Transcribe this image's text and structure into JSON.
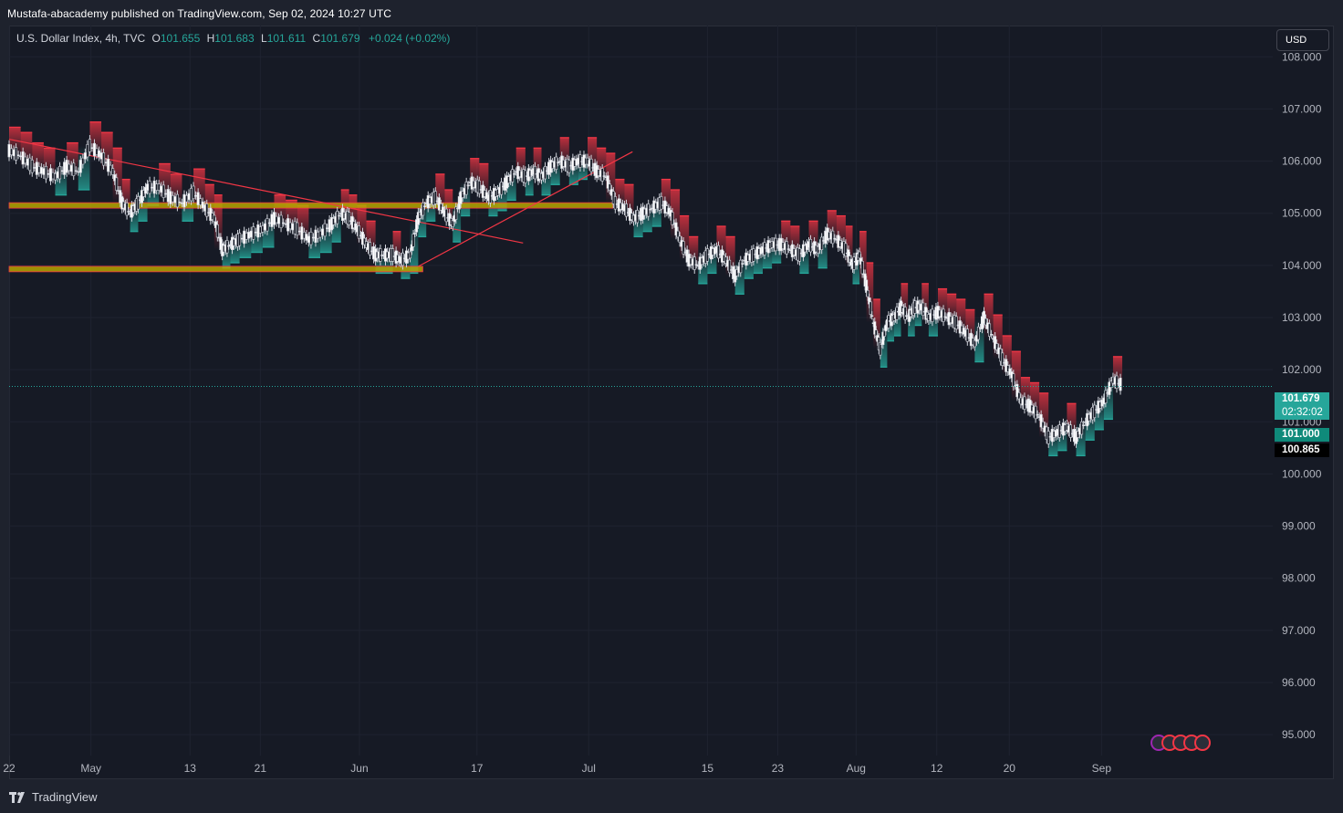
{
  "header": {
    "published": "Mustafa-abacademy published on TradingView.com, Sep 02, 2024 10:27 UTC"
  },
  "legend": {
    "symbol": "U.S. Dollar Index, 4h, TVC",
    "open_label": "O",
    "open": "101.655",
    "high_label": "H",
    "high": "101.683",
    "low_label": "L",
    "low": "101.611",
    "close_label": "C",
    "close": "101.679",
    "change": "+0.024 (+0.02%)"
  },
  "currency_button": "USD",
  "price_badges": {
    "last_price": "101.679",
    "countdown": "02:32:02",
    "level_green": "101.000",
    "level_black": "100.865"
  },
  "footer": {
    "brand": "TradingView"
  },
  "colors": {
    "bg": "#161a25",
    "up": "#26a69a",
    "down": "#f23645",
    "zone": "#b5a600",
    "trendline": "#f23645",
    "grid": "#1f2330"
  },
  "chart_data": {
    "type": "line",
    "symbol": "U.S. Dollar Index",
    "interval": "4h",
    "ylim": [
      94.6,
      108.6
    ],
    "y_ticks": [
      "108.000",
      "107.000",
      "106.000",
      "105.000",
      "104.000",
      "103.000",
      "102.000",
      "101.000",
      "100.000",
      "99.000",
      "98.000",
      "97.000",
      "96.000",
      "95.000"
    ],
    "x_tick_labels": [
      {
        "label": "22",
        "pos": 0.0
      },
      {
        "label": "May",
        "pos": 0.071
      },
      {
        "label": "13",
        "pos": 0.157
      },
      {
        "label": "21",
        "pos": 0.218
      },
      {
        "label": "Jun",
        "pos": 0.304
      },
      {
        "label": "17",
        "pos": 0.406
      },
      {
        "label": "Jul",
        "pos": 0.503
      },
      {
        "label": "15",
        "pos": 0.606
      },
      {
        "label": "23",
        "pos": 0.667
      },
      {
        "label": "Aug",
        "pos": 0.735
      },
      {
        "label": "12",
        "pos": 0.805
      },
      {
        "label": "20",
        "pos": 0.868
      },
      {
        "label": "Sep",
        "pos": 0.948
      }
    ],
    "series": [
      {
        "name": "",
        "points": [
          [
            0.0,
            106.2
          ],
          [
            0.01,
            106.1
          ],
          [
            0.02,
            105.9
          ],
          [
            0.03,
            105.8
          ],
          [
            0.04,
            105.7
          ],
          [
            0.05,
            105.9
          ],
          [
            0.06,
            105.8
          ],
          [
            0.07,
            106.3
          ],
          [
            0.08,
            106.1
          ],
          [
            0.09,
            105.8
          ],
          [
            0.098,
            105.2
          ],
          [
            0.105,
            105.0
          ],
          [
            0.112,
            105.2
          ],
          [
            0.12,
            105.5
          ],
          [
            0.13,
            105.5
          ],
          [
            0.14,
            105.3
          ],
          [
            0.15,
            105.2
          ],
          [
            0.16,
            105.4
          ],
          [
            0.17,
            105.1
          ],
          [
            0.178,
            104.9
          ],
          [
            0.185,
            104.3
          ],
          [
            0.192,
            104.4
          ],
          [
            0.2,
            104.5
          ],
          [
            0.21,
            104.6
          ],
          [
            0.22,
            104.7
          ],
          [
            0.23,
            104.9
          ],
          [
            0.24,
            104.8
          ],
          [
            0.25,
            104.7
          ],
          [
            0.26,
            104.5
          ],
          [
            0.27,
            104.6
          ],
          [
            0.28,
            104.8
          ],
          [
            0.288,
            105.0
          ],
          [
            0.295,
            104.9
          ],
          [
            0.302,
            104.7
          ],
          [
            0.31,
            104.4
          ],
          [
            0.318,
            104.2
          ],
          [
            0.325,
            104.2
          ],
          [
            0.333,
            104.2
          ],
          [
            0.34,
            104.1
          ],
          [
            0.348,
            104.2
          ],
          [
            0.355,
            104.9
          ],
          [
            0.362,
            105.2
          ],
          [
            0.37,
            105.3
          ],
          [
            0.378,
            105.0
          ],
          [
            0.385,
            104.8
          ],
          [
            0.392,
            105.3
          ],
          [
            0.4,
            105.6
          ],
          [
            0.408,
            105.5
          ],
          [
            0.416,
            105.3
          ],
          [
            0.424,
            105.4
          ],
          [
            0.432,
            105.6
          ],
          [
            0.44,
            105.8
          ],
          [
            0.448,
            105.7
          ],
          [
            0.455,
            105.8
          ],
          [
            0.462,
            105.7
          ],
          [
            0.47,
            105.9
          ],
          [
            0.478,
            106.0
          ],
          [
            0.486,
            105.9
          ],
          [
            0.494,
            106.0
          ],
          [
            0.502,
            106.0
          ],
          [
            0.51,
            105.8
          ],
          [
            0.518,
            105.7
          ],
          [
            0.526,
            105.2
          ],
          [
            0.534,
            105.1
          ],
          [
            0.542,
            104.9
          ],
          [
            0.55,
            105.0
          ],
          [
            0.558,
            105.1
          ],
          [
            0.566,
            105.2
          ],
          [
            0.574,
            105.0
          ],
          [
            0.582,
            104.5
          ],
          [
            0.59,
            104.1
          ],
          [
            0.598,
            104.0
          ],
          [
            0.606,
            104.2
          ],
          [
            0.614,
            104.3
          ],
          [
            0.622,
            104.1
          ],
          [
            0.63,
            103.8
          ],
          [
            0.638,
            104.1
          ],
          [
            0.646,
            104.2
          ],
          [
            0.654,
            104.3
          ],
          [
            0.662,
            104.4
          ],
          [
            0.67,
            104.4
          ],
          [
            0.678,
            104.3
          ],
          [
            0.686,
            104.2
          ],
          [
            0.694,
            104.4
          ],
          [
            0.702,
            104.3
          ],
          [
            0.71,
            104.6
          ],
          [
            0.718,
            104.5
          ],
          [
            0.726,
            104.3
          ],
          [
            0.732,
            104.0
          ],
          [
            0.738,
            104.2
          ],
          [
            0.744,
            103.6
          ],
          [
            0.75,
            102.9
          ],
          [
            0.756,
            102.4
          ],
          [
            0.762,
            102.9
          ],
          [
            0.768,
            103.0
          ],
          [
            0.774,
            103.2
          ],
          [
            0.78,
            103.0
          ],
          [
            0.786,
            103.2
          ],
          [
            0.792,
            103.2
          ],
          [
            0.798,
            103.0
          ],
          [
            0.806,
            103.1
          ],
          [
            0.814,
            103.0
          ],
          [
            0.822,
            102.9
          ],
          [
            0.83,
            102.7
          ],
          [
            0.838,
            102.5
          ],
          [
            0.846,
            103.0
          ],
          [
            0.854,
            102.6
          ],
          [
            0.862,
            102.2
          ],
          [
            0.87,
            101.9
          ],
          [
            0.878,
            101.4
          ],
          [
            0.886,
            101.3
          ],
          [
            0.894,
            101.1
          ],
          [
            0.902,
            100.7
          ],
          [
            0.91,
            100.8
          ],
          [
            0.918,
            100.9
          ],
          [
            0.926,
            100.7
          ],
          [
            0.934,
            101.0
          ],
          [
            0.942,
            101.2
          ],
          [
            0.95,
            101.4
          ],
          [
            0.958,
            101.8
          ],
          [
            0.966,
            101.7
          ]
        ]
      }
    ],
    "support_resistance_zones": [
      {
        "price": 105.15,
        "x_start": 0.0,
        "x_end": 0.524
      },
      {
        "price": 103.93,
        "x_start": 0.0,
        "x_end": 0.359
      }
    ],
    "trendlines": [
      {
        "from": [
          0.0,
          106.42
        ],
        "to": [
          0.446,
          104.43
        ]
      },
      {
        "from": [
          0.355,
          103.98
        ],
        "to": [
          0.541,
          106.18
        ]
      }
    ],
    "last_price": 101.679,
    "grid": true
  }
}
